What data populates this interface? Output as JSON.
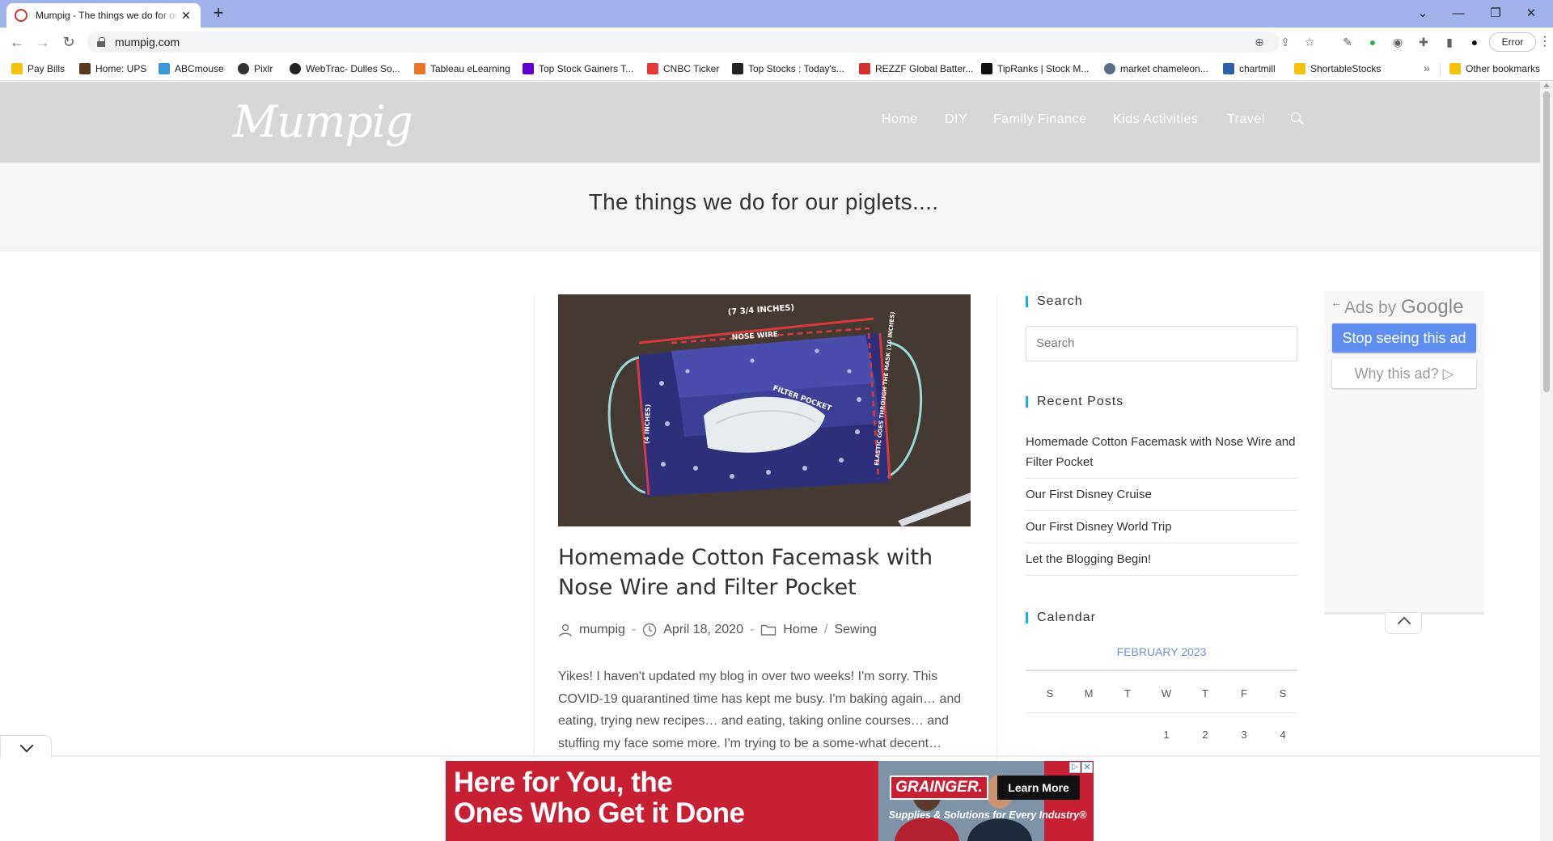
{
  "browser": {
    "tab_title": "Mumpig - The things we do for our piglets....",
    "url": "mumpig.com",
    "error_label": "Error",
    "bookmarks": [
      {
        "label": "Pay Bills",
        "color": "#f4c20d"
      },
      {
        "label": "Home: UPS",
        "color": "#5a3a1e"
      },
      {
        "label": "ABCmouse",
        "color": "#3a9ad9"
      },
      {
        "label": "Pixlr",
        "color": "#333333"
      },
      {
        "label": "WebTrac- Dulles So...",
        "color": "#222222"
      },
      {
        "label": "Tableau eLearning",
        "color": "#e97627"
      },
      {
        "label": "Top Stock Gainers T...",
        "color": "#6001d2"
      },
      {
        "label": "CNBC Ticker",
        "color": "#e53935"
      },
      {
        "label": "Top Stocks : Today's...",
        "color": "#222222"
      },
      {
        "label": "REZZF Global Batter...",
        "color": "#d32f2f"
      },
      {
        "label": "TipRanks | Stock M...",
        "color": "#111111"
      },
      {
        "label": "market chameleon...",
        "color": "#5b6b8a"
      },
      {
        "label": "chartmill",
        "color": "#2d5fa8"
      },
      {
        "label": "ShortableStocks",
        "color": "#f4c20d"
      }
    ],
    "other_bookmarks": "Other bookmarks"
  },
  "site": {
    "logo": "Mumpig",
    "nav": [
      "Home",
      "DIY",
      "Family Finance",
      "Kids Activities",
      "Travel"
    ],
    "tagline": "The things we do for our piglets...."
  },
  "post": {
    "image": {
      "dim_top": "(7 3/4 INCHES)",
      "nose_wire": "NOSE WIRE",
      "filter_pocket": "FILTER POCKET",
      "dim_left": "(4 INCHES)",
      "dim_right": "ELASTIC GOES THROUGH THE MASK (10 INCHES)"
    },
    "title": "Homemade Cotton Facemask with Nose Wire and Filter Pocket",
    "author": "mumpig",
    "date": "April 18, 2020",
    "category_1": "Home",
    "category_sep": "/",
    "category_2": "Sewing",
    "excerpt": "Yikes! I haven't updated my blog in over two weeks! I'm sorry. This COVID-19 quarantined time has kept me busy. I'm baking again… and eating, trying new recipes… and eating, taking online courses… and stuffing my face some more. I'm trying to be a some-what decent…"
  },
  "sidebar": {
    "search_title": "Search",
    "search_placeholder": "Search",
    "recent_title": "Recent Posts",
    "recent_posts": [
      "Homemade Cotton Facemask with Nose Wire and Filter Pocket",
      "Our First Disney Cruise",
      "Our First Disney World Trip",
      "Let the Blogging Begin!"
    ],
    "calendar_title": "Calendar",
    "calendar_caption": "FEBRUARY 2023",
    "calendar_headers": [
      "S",
      "M",
      "T",
      "W",
      "T",
      "F",
      "S"
    ],
    "calendar_first_row": [
      "",
      "",
      "",
      "1",
      "2",
      "3",
      "4"
    ]
  },
  "ads_panel": {
    "ads_by": "Ads by",
    "google": "Google",
    "stop": "Stop seeing this ad",
    "why": "Why this ad? ▷"
  },
  "banner": {
    "headline": "Here for You, the Ones Who Get it Done",
    "brand": "GRAINGER.",
    "cta": "Learn More",
    "sub": "Supplies & Solutions for Every Industry®"
  }
}
